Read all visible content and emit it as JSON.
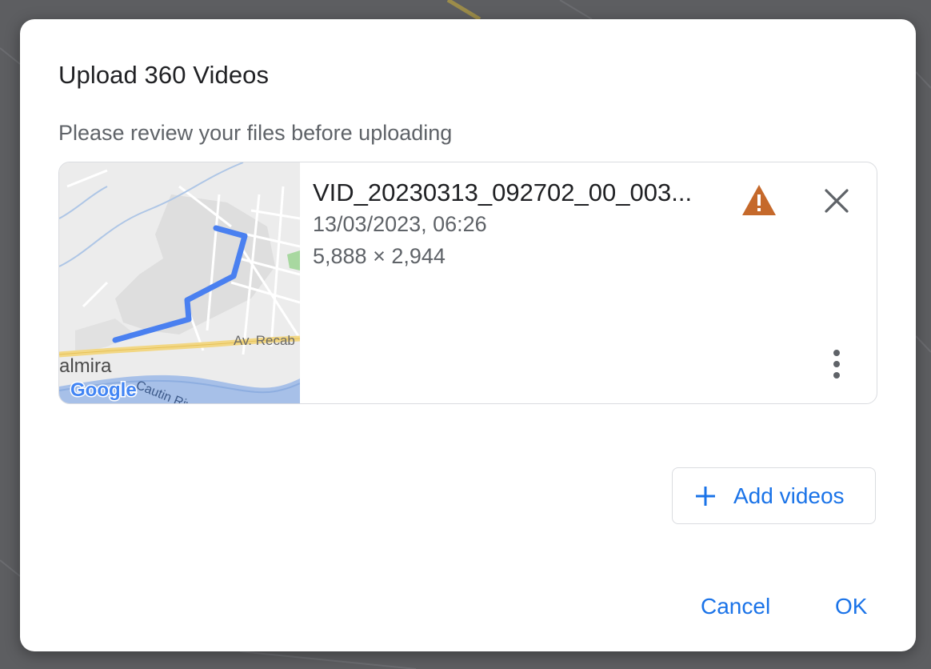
{
  "dialog": {
    "title": "Upload 360 Videos",
    "subtitle": "Please review your files before uploading"
  },
  "file": {
    "name": "VID_20230313_092702_00_003...",
    "date": "13/03/2023, 06:26",
    "dimensions": "5,888 × 2,944",
    "thumbnail": {
      "map_labels": [
        "Av. Recab",
        "almira",
        "Cautin River"
      ],
      "logo_text": "Google"
    },
    "warning_icon": "warning-icon",
    "remove_icon": "close-icon",
    "menu_icon": "more-vert-icon"
  },
  "actions": {
    "add_videos": "Add videos",
    "cancel": "Cancel",
    "ok": "OK"
  },
  "colors": {
    "accent": "#1a73e8",
    "warning": "#c5692b",
    "route": "#4a80f0"
  }
}
